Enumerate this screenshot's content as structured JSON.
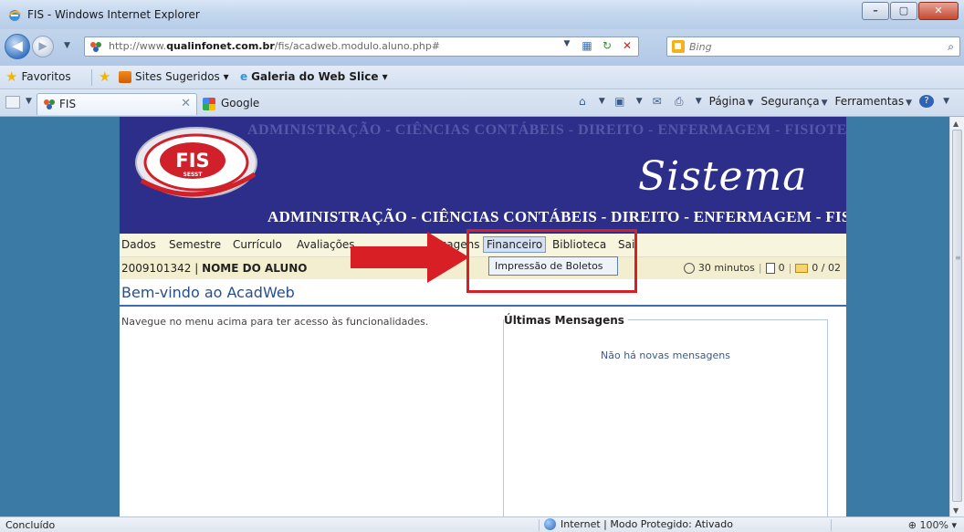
{
  "window": {
    "title": "FIS - Windows Internet Explorer"
  },
  "address": {
    "url_prefix": "http://www.",
    "url_domain": "qualinfonet.com.br",
    "url_path": "/fis/acadweb.modulo.aluno.php#",
    "search_placeholder": "Bing"
  },
  "favorites_bar": {
    "favorites": "Favoritos",
    "suggested_sites": "Sites Sugeridos ▾",
    "web_slice": "Galeria do Web Slice ▾"
  },
  "tabs": {
    "active": "FIS",
    "new": "Google"
  },
  "command_bar": {
    "page": "Página",
    "security": "Segurança",
    "tools": "Ferramentas"
  },
  "banner": {
    "faded_text": "ADMINISTRAÇÃO - CIÊNCIAS CONTÁBEIS - DIREITO - ENFERMAGEM - FISIOTERAPIA",
    "courses": "ADMINISTRAÇÃO - CIÊNCIAS CONTÁBEIS - DIREITO - ENFERMAGEM - FISIOTERAPIA",
    "title": "Sistema",
    "logo": {
      "main": "FIS",
      "sub": "SESST"
    }
  },
  "menu": {
    "dados": "Dados",
    "semestre": "Semestre",
    "curriculo": "Currículo",
    "avaliacoes": "Avaliações",
    "mensagens_tail": "sagens",
    "financeiro": "Financeiro",
    "biblioteca": "Biblioteca",
    "sair": "Sai"
  },
  "dropdown": {
    "boletos": "Impressão de Boletos"
  },
  "user": {
    "id": "2009101342",
    "separator": "|",
    "name": "NOME DO ALUNO",
    "session_time": "30 minutos",
    "docs_count": "0",
    "messages_count": "0 / 02"
  },
  "main": {
    "welcome": "Bem-vindo ao AcadWeb",
    "nav_hint": "Navegue no menu acima para ter acesso às funcionalidades.",
    "messages_title": "Últimas Mensagens",
    "messages_empty": "Não há novas mensagens"
  },
  "status": {
    "left": "Concluído",
    "zone": "Internet | Modo Protegido: Ativado",
    "zoom": "100%"
  },
  "colors": {
    "banner": "#2c2e8a",
    "menu_bg": "#f8f5df",
    "highlight": "#d81f25",
    "page_bg": "#3a7aa4"
  }
}
